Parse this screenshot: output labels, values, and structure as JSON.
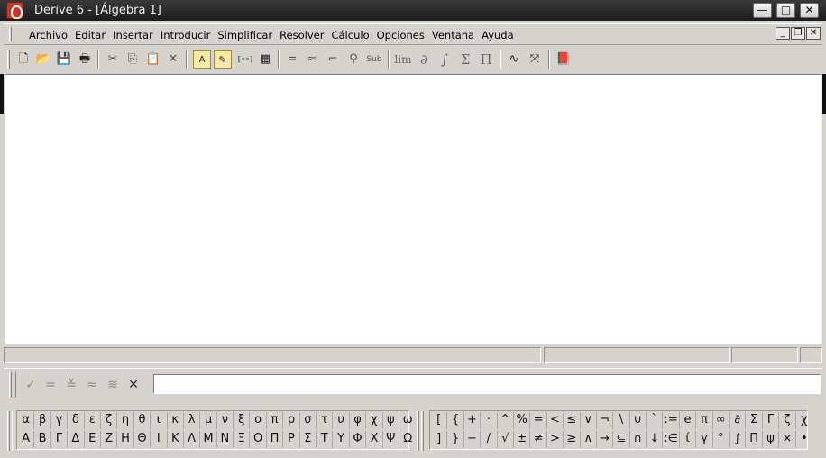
{
  "window": {
    "title": "Derive 6 - [Álgebra 1]",
    "minimize_glyph": "—",
    "maximize_glyph": "□",
    "close_glyph": "✕"
  },
  "menu": {
    "items": [
      "Archivo",
      "Editar",
      "Insertar",
      "Introducir",
      "Simplificar",
      "Resolver",
      "Cálculo",
      "Opciones",
      "Ventana",
      "Ayuda"
    ],
    "child_minimize": "_",
    "child_restore": "❐",
    "child_close": "✕"
  },
  "toolbar": {
    "new": "🗋",
    "open": "📂",
    "save": "💾",
    "print": "🖶",
    "cut": "✂",
    "copy": "⎘",
    "paste": "📋",
    "delete": "✕",
    "insert_text": "A",
    "insert_note": "✎",
    "vector": "[∘∘]",
    "matrix": "▦",
    "equals": "=",
    "approx": "≈",
    "steps": "⌐",
    "zoom": "⚲",
    "sub": "Sub",
    "limit": "lim",
    "derivative": "∂",
    "integral": "∫",
    "sum": "Σ",
    "product": "Π",
    "plot2d": "∿",
    "plot3d": "⤧",
    "book": "📕"
  },
  "input_tools": {
    "check": "✓",
    "equals": "=",
    "simplify": "≚",
    "approx": "≈",
    "approx2": "≋",
    "clear": "✕"
  },
  "input_field": {
    "value": "",
    "placeholder": ""
  },
  "greek_lower": [
    "α",
    "β",
    "γ",
    "δ",
    "ε",
    "ζ",
    "η",
    "θ",
    "ι",
    "κ",
    "λ",
    "μ",
    "ν",
    "ξ",
    "ο",
    "π",
    "ρ",
    "σ",
    "τ",
    "υ",
    "φ",
    "χ",
    "ψ",
    "ω"
  ],
  "greek_upper": [
    "Α",
    "Β",
    "Γ",
    "Δ",
    "Ε",
    "Ζ",
    "Η",
    "Θ",
    "Ι",
    "Κ",
    "Λ",
    "Μ",
    "Ν",
    "Ξ",
    "Ο",
    "Π",
    "Ρ",
    "Σ",
    "Τ",
    "Υ",
    "Φ",
    "Χ",
    "Ψ",
    "Ω"
  ],
  "math_row1": [
    "[",
    "{",
    "+",
    "·",
    "^",
    "%",
    "=",
    "<",
    "≤",
    "∨",
    "¬",
    "\\",
    "∪",
    "`",
    ":=",
    "e",
    "π",
    "∞",
    "∂",
    "Σ",
    "Γ",
    "ζ",
    "χ"
  ],
  "math_row2": [
    "]",
    "}",
    "−",
    "/",
    "√",
    "±",
    "≠",
    ">",
    "≥",
    "∧",
    "→",
    "⊆",
    "∩",
    "↓",
    ":∈",
    "ί",
    "γ",
    "°",
    "∫",
    "Π",
    "ψ",
    "×",
    "•"
  ]
}
